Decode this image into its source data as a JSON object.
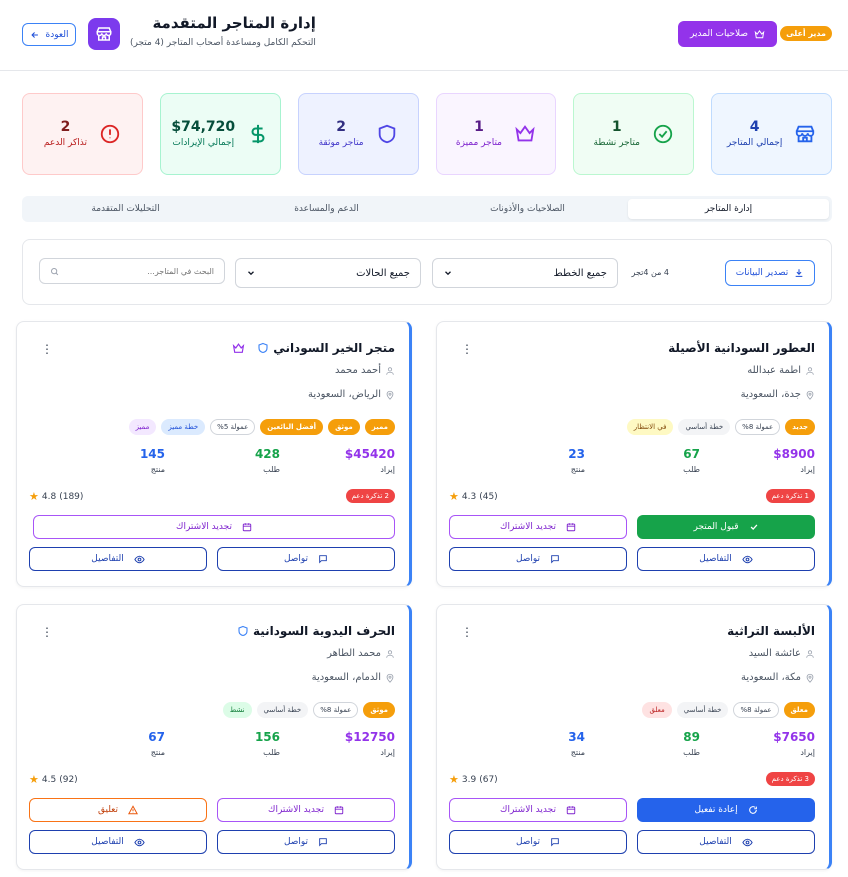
{
  "header": {
    "admin_badge": "مدير أعلى",
    "perms_button": "صلاحيات المدير",
    "title": "إدارة المتاجر المتقدمة",
    "subtitle": "التحكم الكامل ومساعدة أصحاب المتاجر (4 متجر)",
    "back_button": "العودة"
  },
  "stats": [
    {
      "value": "4",
      "label": "إجمالي المتاجر",
      "icon": "store-icon"
    },
    {
      "value": "1",
      "label": "متاجر نشطة",
      "icon": "check-circle-icon"
    },
    {
      "value": "1",
      "label": "متاجر مميزة",
      "icon": "crown-icon"
    },
    {
      "value": "2",
      "label": "متاجر موثقة",
      "icon": "shield-icon"
    },
    {
      "value": "$74,720",
      "label": "إجمالي الإيرادات",
      "icon": "dollar-icon"
    },
    {
      "value": "2",
      "label": "تذاكر الدعم",
      "icon": "alert-circle-icon"
    }
  ],
  "tabs": [
    "التحليلات المتقدمة",
    "الدعم والمساعدة",
    "الصلاحيات والأذونات",
    "إدارة المتاجر"
  ],
  "active_tab": "إدارة المتاجر",
  "filters": {
    "export_button": "تصدير البيانات",
    "count_text": "4 من 4تجر",
    "plans_select": "جميع الخطط",
    "status_select": "جميع الحالات",
    "search_placeholder": "البحث في المتاجر..."
  },
  "labels": {
    "revenue": "إيراد",
    "orders": "طلب",
    "products": "منتج",
    "renew": "تجديد الاشتراك",
    "contact": "تواصل",
    "details": "التفاصيل",
    "accept": "قبول المتجر",
    "suspend": "تعليق",
    "reactivate": "إعادة تفعيل"
  },
  "stores": [
    {
      "name": "العطور السودانية الأصيلة",
      "owner": "اطمة عبدالله",
      "location": "جدة، السعودية",
      "tags": [
        {
          "text": "جديد",
          "style": "amber"
        },
        {
          "text": "عمولة 8%",
          "style": "outline"
        },
        {
          "text": "خطة أساسي",
          "style": "grey"
        },
        {
          "text": "في الانتظار",
          "style": "yellow"
        }
      ],
      "revenue": "$8900",
      "orders": "67",
      "products": "23",
      "tickets": "1 تذكرة دعم",
      "rating": "4.3",
      "reviews": "(45)"
    },
    {
      "name": "متجر الخير السوداني",
      "owner": "أحمد محمد",
      "location": "الرياض، السعودية",
      "tags": [
        {
          "text": "مميز",
          "style": "amber"
        },
        {
          "text": "موثق",
          "style": "amber"
        },
        {
          "text": "أفضل البائعين",
          "style": "amber"
        },
        {
          "text": "عمولة 5%",
          "style": "outline"
        },
        {
          "text": "خطة مميز",
          "style": "blue"
        },
        {
          "text": "مميز",
          "style": "purple"
        }
      ],
      "revenue": "$45420",
      "orders": "428",
      "products": "145",
      "tickets": "2 تذكرة دعم",
      "rating": "4.8",
      "reviews": "(189)"
    },
    {
      "name": "الألبسة التراثية",
      "owner": "عائشة السيد",
      "location": "مكة، السعودية",
      "tags": [
        {
          "text": "معلق",
          "style": "amber"
        },
        {
          "text": "عمولة 8%",
          "style": "outline"
        },
        {
          "text": "خطة أساسي",
          "style": "grey"
        },
        {
          "text": "معلق",
          "style": "red"
        }
      ],
      "revenue": "$7650",
      "orders": "89",
      "products": "34",
      "tickets": "3 تذكرة دعم",
      "rating": "3.9",
      "reviews": "(67)"
    },
    {
      "name": "الحرف اليدوية السودانية",
      "owner": "محمد الطاهر",
      "location": "الدمام، السعودية",
      "tags": [
        {
          "text": "موثق",
          "style": "amber"
        },
        {
          "text": "عمولة 8%",
          "style": "outline"
        },
        {
          "text": "خطة أساسي",
          "style": "grey"
        },
        {
          "text": "نشط",
          "style": "green"
        }
      ],
      "revenue": "$12750",
      "orders": "156",
      "products": "67",
      "rating": "4.5",
      "reviews": "(92)"
    }
  ],
  "colors": {
    "primary_purple": "#9333ea",
    "accent_blue": "#3b82f6",
    "amber": "#f59e0b",
    "success_green": "#16a34a",
    "danger_red": "#ef4444"
  }
}
